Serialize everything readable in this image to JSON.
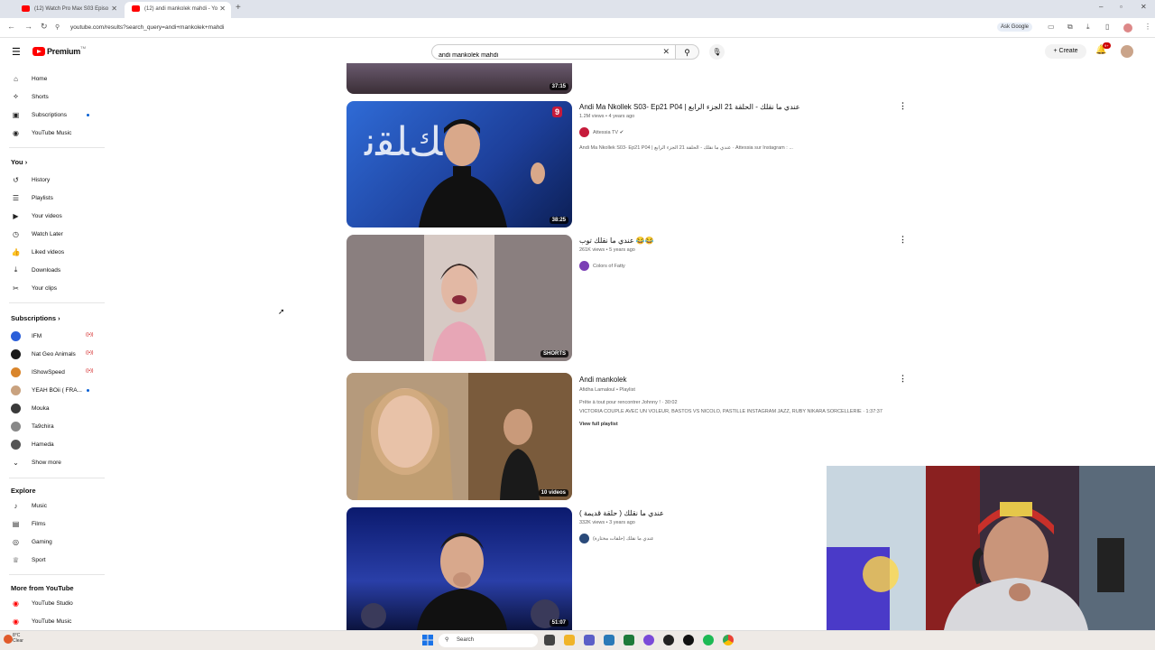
{
  "browser": {
    "tabs": [
      {
        "title": "(12) Watch Pro Max S03 Episo"
      },
      {
        "title": "(12) andi mankolek mahdi - Yo"
      }
    ],
    "url": "youtube.com/results?search_query=andi+mankolek+mahdi",
    "ask_google": "Ask Google"
  },
  "header": {
    "logo_text": "Premium",
    "logo_tm": "TM",
    "search_value": "andi mankolek mahdi",
    "create_label": "Create",
    "notif_count": "9+"
  },
  "sidebar": {
    "main": [
      {
        "label": "Home",
        "icon": "home-icon"
      },
      {
        "label": "Shorts",
        "icon": "shorts-icon"
      },
      {
        "label": "Subscriptions",
        "icon": "subscriptions-icon"
      },
      {
        "label": "YouTube Music",
        "icon": "music-icon"
      }
    ],
    "you_header": "You",
    "you": [
      {
        "label": "History",
        "icon": "history-icon"
      },
      {
        "label": "Playlists",
        "icon": "playlists-icon"
      },
      {
        "label": "Your videos",
        "icon": "your-videos-icon"
      },
      {
        "label": "Watch Later",
        "icon": "clock-icon"
      },
      {
        "label": "Liked videos",
        "icon": "like-icon"
      },
      {
        "label": "Downloads",
        "icon": "download-icon"
      },
      {
        "label": "Your clips",
        "icon": "scissors-icon"
      }
    ],
    "subs_header": "Subscriptions",
    "subs": [
      {
        "label": "IFM",
        "color": "#2b5fd9"
      },
      {
        "label": "Nat Geo Animals",
        "color": "#1a1a1a"
      },
      {
        "label": "IShowSpeed",
        "color": "#d9852b"
      },
      {
        "label": "YEAH BOii ( FRA...",
        "color": "#c9a27f"
      },
      {
        "label": "Mouka",
        "color": "#3a3a3a"
      },
      {
        "label": "Ta9chira",
        "color": "#888888"
      },
      {
        "label": "Hameda",
        "color": "#555555"
      }
    ],
    "show_more": "Show more",
    "explore_header": "Explore",
    "explore": [
      {
        "label": "Music",
        "icon": "music-note-icon"
      },
      {
        "label": "Films",
        "icon": "film-icon"
      },
      {
        "label": "Gaming",
        "icon": "gaming-icon"
      },
      {
        "label": "Sport",
        "icon": "trophy-icon"
      }
    ],
    "more_header": "More from YouTube",
    "more": [
      {
        "label": "YouTube Studio"
      },
      {
        "label": "YouTube Music"
      }
    ]
  },
  "results": [
    {
      "duration": "37:15"
    },
    {
      "title": "Andi Ma Nkollek S03- Ep21 P04 | عندي ما نقلك - الحلقة 21 الجزء الرابع",
      "meta": "1.2M views • 4 years ago",
      "channel": "Attessia TV",
      "description": "Andi Ma Nkollek S03- Ep21 P04 | عندي ما نقلك - الحلقة 21 الجزء الرابع · Attessia sur Instagram : ...",
      "duration": "38:25",
      "badge": "9"
    },
    {
      "title": "عندي ما نقلك توب 😂😂",
      "meta": "261K views • 5 years ago",
      "channel": "Colors of Fatty",
      "duration": "SHORTS"
    },
    {
      "title": "Andi mankolek",
      "meta": "Afidha Lamaloul • Playlist",
      "desc1": "Prête à tout pour rencontrer Johnny ! · 30:02",
      "desc2": "VICTORIA COUPLE AVEC UN VOLEUR, BASTOS VS NICOLO, PASTILLE INSTAGRAM JAZZ, RUBY NIKARA SORCELLERIE · 1:37:37",
      "view_full": "View full playlist",
      "duration": "10 videos"
    },
    {
      "title": "عندي ما نقلك ( حلقة قديمة )",
      "meta": "332K views • 3 years ago",
      "channel": "عندي ما نقلك (حلقات مختارة)",
      "duration": "51:07"
    }
  ],
  "taskbar": {
    "temp": "8°C",
    "condition": "Clear",
    "search": "Search"
  }
}
